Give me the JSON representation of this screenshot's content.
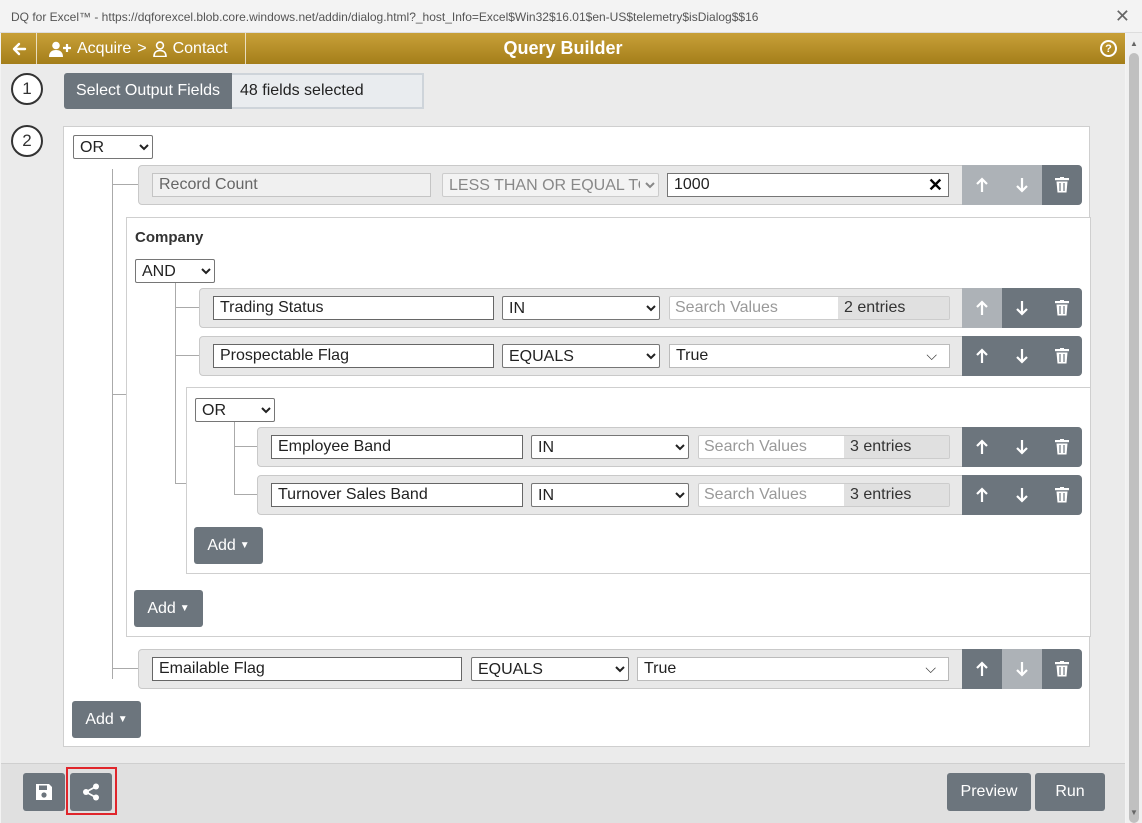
{
  "window": {
    "title": "DQ for Excel™ - https://dqforexcel.blob.core.windows.net/addin/dialog.html?_host_Info=Excel$Win32$16.01$en-US$telemetry$isDialog$$16",
    "close": "✕"
  },
  "header": {
    "back_icon": "arrow-left-icon",
    "breadcrumb_acquire": "Acquire",
    "breadcrumb_sep": ">",
    "breadcrumb_contact": "Contact",
    "title": "Query Builder",
    "help": "?",
    "accent_color": "#b48c25"
  },
  "step1": {
    "number": "1",
    "button": "Select Output Fields",
    "value": "48 fields selected"
  },
  "step2": {
    "number": "2",
    "root_operator": "OR",
    "operators": [
      "OR",
      "AND"
    ],
    "record_count": {
      "field": "Record Count",
      "comparator": "LESS THAN OR EQUAL TO",
      "value": "1000",
      "clear": "✕"
    },
    "company": {
      "label": "Company",
      "operator": "AND",
      "trading_status": {
        "field": "Trading Status",
        "comparator": "IN",
        "search_placeholder": "Search Values",
        "count": "2 entries"
      },
      "prospectable": {
        "field": "Prospectable Flag",
        "comparator": "EQUALS",
        "value": "True"
      },
      "nested": {
        "operator": "OR",
        "employee_band": {
          "field": "Employee Band",
          "comparator": "IN",
          "search_placeholder": "Search Values",
          "count": "3 entries"
        },
        "turnover": {
          "field": "Turnover Sales Band",
          "comparator": "IN",
          "search_placeholder": "Search Values",
          "count": "3 entries"
        },
        "add": "Add"
      },
      "add": "Add"
    },
    "emailable": {
      "field": "Emailable Flag",
      "comparator": "EQUALS",
      "value": "True"
    },
    "add": "Add"
  },
  "footer": {
    "save_icon": "floppy-disk-icon",
    "share_icon": "share-icon",
    "preview": "Preview",
    "run": "Run"
  }
}
